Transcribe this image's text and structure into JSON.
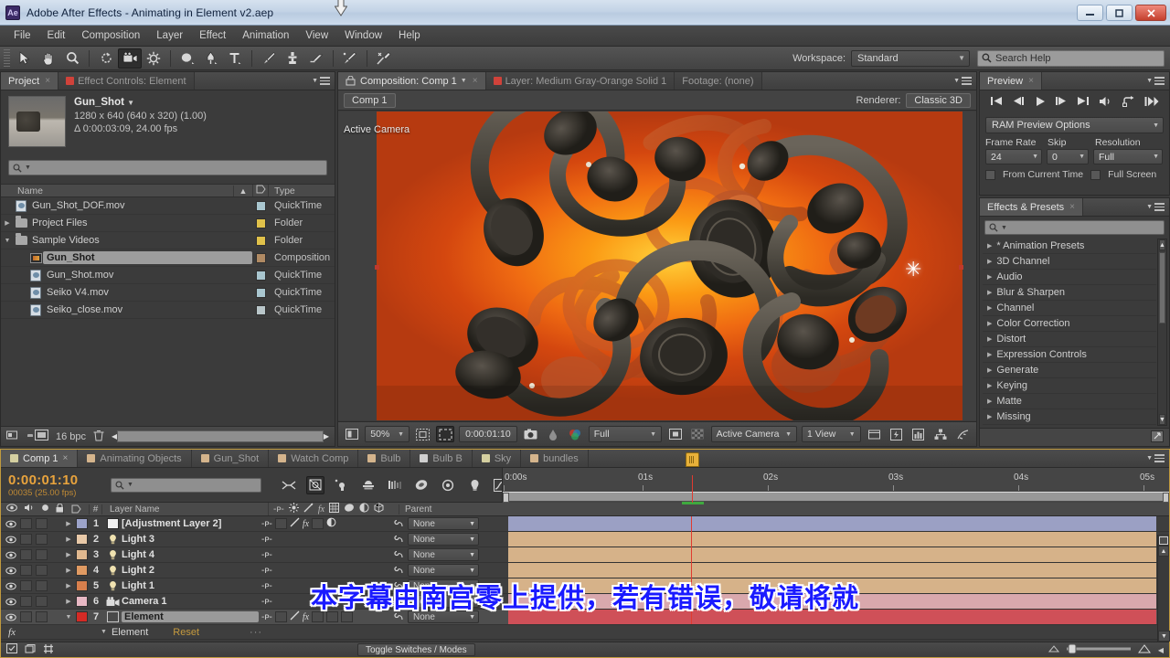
{
  "titlebar": {
    "logo": "Ae",
    "title": "Adobe After Effects - Animating in Element v2.aep",
    "minimize": "–",
    "maximize": "▭",
    "close": "✕"
  },
  "menubar": {
    "items": [
      "File",
      "Edit",
      "Composition",
      "Layer",
      "Effect",
      "Animation",
      "View",
      "Window",
      "Help"
    ]
  },
  "toolbar": {
    "workspace_label": "Workspace:",
    "workspace_value": "Standard",
    "search_help_placeholder": "Search Help",
    "tools": [
      "selection-tool",
      "hand-tool",
      "zoom-tool",
      "rotation-tool",
      "camera-tool",
      "pan-behind-tool",
      "shape-tool",
      "pen-tool",
      "type-tool",
      "brush-tool",
      "clone-stamp-tool",
      "eraser-tool",
      "roto-brush-tool",
      "puppet-pin-tool"
    ]
  },
  "project_panel": {
    "tabs": [
      {
        "label": "Project",
        "active": true,
        "closable": true
      },
      {
        "label": "Effect Controls: Element",
        "active": false,
        "closable": false
      }
    ],
    "item_name": "Gun_Shot",
    "item_dims": "1280 x 640  (640 x 320) (1.00)",
    "item_duration": "Δ 0:00:03:09, 24.00 fps",
    "search_placeholder": "",
    "columns": [
      "Name",
      "Type"
    ],
    "rows": [
      {
        "name": "Gun_Shot_DOF.mov",
        "type": "QuickTime",
        "icon": "movie-icon",
        "indent": 1,
        "color": "#a9c6cf",
        "twisty": "",
        "selected": false
      },
      {
        "name": "Project Files",
        "type": "Folder",
        "icon": "folder-icon",
        "indent": 0,
        "color": "#e0c14a",
        "twisty": "▶",
        "selected": false
      },
      {
        "name": "Sample Videos",
        "type": "Folder",
        "icon": "folder-icon",
        "indent": 0,
        "color": "#e0c14a",
        "twisty": "▼",
        "selected": false
      },
      {
        "name": "Gun_Shot",
        "type": "Composition",
        "icon": "comp-icon",
        "indent": 2,
        "color": "#b08a63",
        "twisty": "",
        "selected": true
      },
      {
        "name": "Gun_Shot.mov",
        "type": "QuickTime",
        "icon": "movie-icon",
        "indent": 2,
        "color": "#a9c6cf",
        "twisty": "",
        "selected": false
      },
      {
        "name": "Seiko V4.mov",
        "type": "QuickTime",
        "icon": "movie-icon",
        "indent": 2,
        "color": "#a9c6cf",
        "twisty": "",
        "selected": false
      },
      {
        "name": "Seiko_close.mov",
        "type": "QuickTime",
        "icon": "movie-icon",
        "indent": 2,
        "color": "#b9c6c9",
        "twisty": "",
        "selected": false
      }
    ],
    "footer_bpc": "16 bpc"
  },
  "comp_panel": {
    "tabs": [
      {
        "label": "Composition: Comp 1",
        "active": true
      },
      {
        "label": "Layer: Medium Gray-Orange Solid 1",
        "active": false
      },
      {
        "label": "Footage: (none)",
        "active": false
      }
    ],
    "comp_chip": "Comp 1",
    "renderer_label": "Renderer:",
    "renderer_value": "Classic 3D",
    "view_overlay": "Active Camera",
    "toolbar": {
      "magnification": "50%",
      "timecode": "0:00:01:10",
      "resolution": "Full",
      "view_select": "Active Camera",
      "views": "1 View"
    }
  },
  "preview_panel": {
    "tab": "Preview",
    "ram_preview_options": "RAM Preview Options",
    "frame_rate_label": "Frame Rate",
    "skip_label": "Skip",
    "resolution_label": "Resolution",
    "frame_rate_value": "24",
    "skip_value": "0",
    "resolution_value": "Full",
    "from_current_time": "From Current Time",
    "full_screen": "Full Screen"
  },
  "effects_panel": {
    "tab": "Effects & Presets",
    "search_placeholder": "",
    "items": [
      "* Animation Presets",
      "3D Channel",
      "Audio",
      "Blur & Sharpen",
      "Channel",
      "Color Correction",
      "Distort",
      "Expression Controls",
      "Generate",
      "Keying",
      "Matte",
      "Missing"
    ]
  },
  "timeline": {
    "tabs": [
      {
        "label": "Comp 1",
        "active": true,
        "color": "#d4cfa0"
      },
      {
        "label": "Animating Objects",
        "active": false,
        "color": "#d4b48c"
      },
      {
        "label": "Gun_Shot",
        "active": false,
        "color": "#d4b48c"
      },
      {
        "label": "Watch Comp",
        "active": false,
        "color": "#d4b48c"
      },
      {
        "label": "Bulb",
        "active": false,
        "color": "#d4b48c"
      },
      {
        "label": "Bulb B",
        "active": false,
        "color": "#cfcfcf"
      },
      {
        "label": "Sky",
        "active": false,
        "color": "#d4cfa0"
      },
      {
        "label": "bundles",
        "active": false,
        "color": "#d4b48c"
      }
    ],
    "current_time": "0:00:01:10",
    "frame_info": "00035 (25.00 fps)",
    "search_placeholder": "",
    "ruler_labels": [
      "0:00s",
      "01s",
      "02s",
      "03s",
      "04s",
      "05s"
    ],
    "columns": {
      "layer_name": "Layer Name",
      "parent": "Parent"
    },
    "layers": [
      {
        "num": "1",
        "name": "[Adjustment Layer 2]",
        "color": "#9ca3c9",
        "icon": "solid-icon",
        "parent": "None",
        "track_color": "#9ba0c4",
        "has_fx": true,
        "selected": false
      },
      {
        "num": "2",
        "name": "Light 3",
        "color": "#e8c9a8",
        "icon": "light-icon",
        "parent": "None",
        "track_color": "#d6b289",
        "has_fx": false,
        "selected": false
      },
      {
        "num": "3",
        "name": "Light 4",
        "color": "#e0b88f",
        "icon": "light-icon",
        "parent": "None",
        "track_color": "#d6b289",
        "has_fx": false,
        "selected": false
      },
      {
        "num": "4",
        "name": "Light 2",
        "color": "#e09a62",
        "icon": "light-icon",
        "parent": "None",
        "track_color": "#d6b289",
        "has_fx": false,
        "selected": false
      },
      {
        "num": "5",
        "name": "Light 1",
        "color": "#d87f4c",
        "icon": "light-icon",
        "parent": "None",
        "track_color": "#d6b289",
        "has_fx": false,
        "selected": false
      },
      {
        "num": "6",
        "name": "Camera 1",
        "color": "#e8b8c4",
        "icon": "camera-icon",
        "parent": "None",
        "track_color": "#d9a8ad",
        "has_fx": false,
        "selected": false
      },
      {
        "num": "7",
        "name": "Element",
        "color": "#d42a25",
        "icon": "solid-icon",
        "parent": "None",
        "track_color": "#cf5058",
        "has_fx": true,
        "selected": true
      }
    ],
    "effect_row": {
      "name": "Element",
      "reset": "Reset"
    },
    "toggle_switches": "Toggle Switches / Modes"
  },
  "subtitle": "本字幕由南宫零上提供，若有错误，敬请将就",
  "icons": {
    "search": "⌕",
    "chevron_down": "▼",
    "chevron_right": "▶",
    "close_x": "×",
    "sparkle": "✸"
  }
}
